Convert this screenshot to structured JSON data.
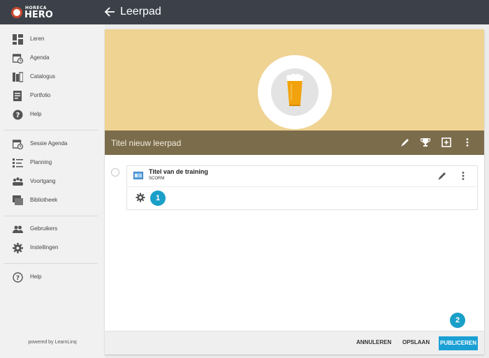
{
  "app": {
    "logo_small": "HORECA",
    "logo_big": "HERO",
    "page_title": "Leerpad"
  },
  "sidebar": {
    "items": [
      {
        "label": "Leren",
        "icon": "grid-icon"
      },
      {
        "label": "Agenda",
        "icon": "calendar-clock-icon"
      },
      {
        "label": "Catalogus",
        "icon": "books-icon"
      },
      {
        "label": "Portfolio",
        "icon": "portfolio-icon"
      },
      {
        "label": "Help",
        "icon": "help-icon"
      },
      {
        "label": "Sessie Agenda",
        "icon": "calendar-clock-icon"
      },
      {
        "label": "Planning",
        "icon": "planning-icon"
      },
      {
        "label": "Voortgang",
        "icon": "group-icon"
      },
      {
        "label": "Bibliotheek",
        "icon": "library-icon"
      },
      {
        "label": "Gebruikers",
        "icon": "users-icon"
      },
      {
        "label": "Instellingen",
        "icon": "gear-icon"
      },
      {
        "label": "Help",
        "icon": "help-circle-icon"
      }
    ],
    "powered_by": "powered by LearnLinq"
  },
  "learning_path": {
    "title": "Titel nieuw leerpad",
    "training": {
      "title": "Titel van de training",
      "type": "SCORM"
    },
    "badge_1": "1",
    "badge_2": "2"
  },
  "footer": {
    "cancel_label": "ANNULEREN",
    "save_label": "OPSLAAN",
    "publish_label": "PUBLICEREN"
  },
  "colors": {
    "topbar": "#3c4149",
    "banner": "#efd393",
    "title_bar": "#7b6c4c",
    "accent": "#1ba0d5"
  }
}
